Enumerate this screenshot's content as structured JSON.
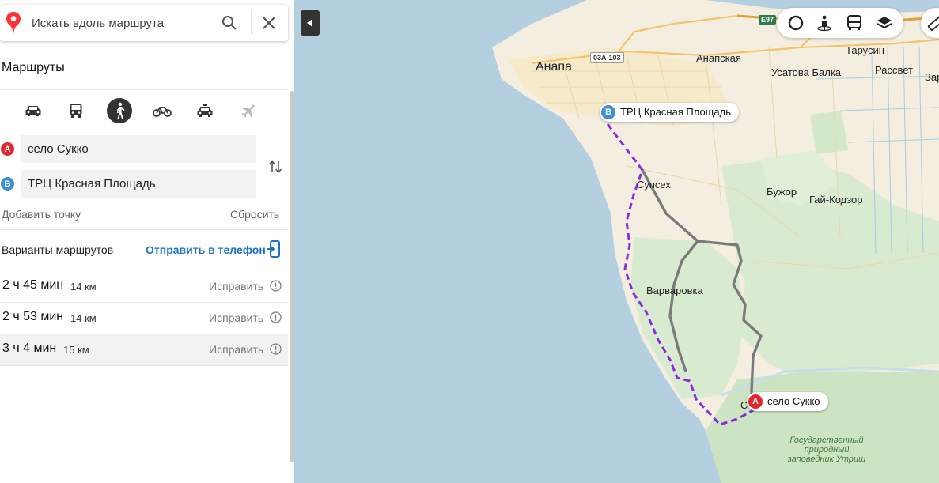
{
  "search": {
    "placeholder": "Искать вдоль маршрута"
  },
  "sidebar": {
    "title": "Маршруты",
    "modes": [
      {
        "icon": "car-icon",
        "active": false
      },
      {
        "icon": "bus-icon",
        "active": false
      },
      {
        "icon": "pedestrian-icon",
        "active": true
      },
      {
        "icon": "bicycle-icon",
        "active": false
      },
      {
        "icon": "taxi-icon",
        "active": false
      },
      {
        "icon": "plane-icon",
        "active": false
      }
    ],
    "points": [
      {
        "marker": "A",
        "value": "село Сукко",
        "color": "#e2262b"
      },
      {
        "marker": "B",
        "value": "ТРЦ Красная Площадь",
        "color": "#3f8fd6"
      }
    ],
    "add_point": "Добавить точку",
    "reset": "Сбросить",
    "variants_label": "Варианты маршрутов",
    "send_to_phone": "Отправить в телефон",
    "routes": [
      {
        "duration": "2 ч 45 мин",
        "distance": "14 км",
        "fix": "Исправить",
        "selected": false
      },
      {
        "duration": "2 ч 53 мин",
        "distance": "14 км",
        "fix": "Исправить",
        "selected": false
      },
      {
        "duration": "3 ч 4 мин",
        "distance": "15 км",
        "fix": "Исправить",
        "selected": true
      }
    ]
  },
  "map": {
    "route_color": "#8a2be2",
    "places": {
      "anapa": "Анапа",
      "anapskaya": "Анапская",
      "tarusin": "Тарусин",
      "usatova_balka": "Усатова Балка",
      "rassvet": "Рассвет",
      "zarya": "Заря",
      "supsekh": "Супсех",
      "buzhor": "Бужор",
      "gai_kodzor": "Гай-Кодзор",
      "varvarovka": "Варваровка",
      "reserve_line1": "Государственный",
      "reserve_line2": "природный",
      "reserve_line3": "заповедник Утриш",
      "sukko_short": "С"
    },
    "roads": {
      "e97": "E97",
      "r03a103": "03А-103"
    },
    "marker_a": {
      "letter": "A",
      "label": "село Сукко"
    },
    "marker_b": {
      "letter": "B",
      "label": "ТРЦ Красная Площадь"
    }
  }
}
